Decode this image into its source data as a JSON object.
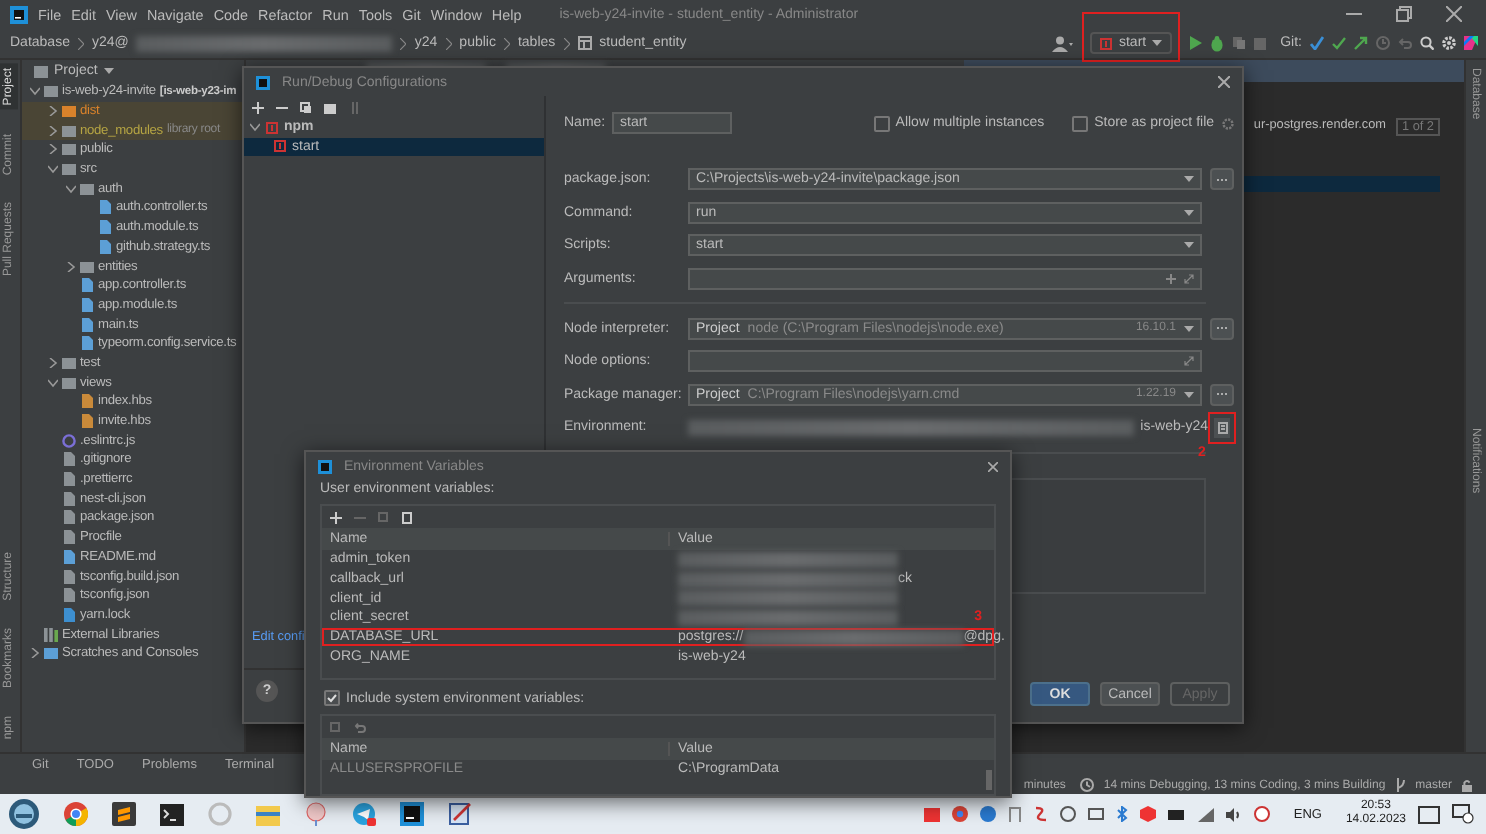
{
  "window": {
    "title": "is-web-y24-invite - student_entity - Administrator",
    "menu": [
      "File",
      "Edit",
      "View",
      "Navigate",
      "Code",
      "Refactor",
      "Run",
      "Tools",
      "Git",
      "Window",
      "Help"
    ]
  },
  "breadcrumbs": [
    "Database",
    "y24@",
    "y24",
    "public",
    "tables",
    "student_entity"
  ],
  "toolbar": {
    "run_config": "start",
    "run_config_marked": true,
    "git_label": "Git:"
  },
  "left_tool_tabs_top": [
    {
      "label": "Project",
      "selected": true
    },
    {
      "label": "Commit",
      "selected": false
    },
    {
      "label": "Pull Requests",
      "selected": false
    }
  ],
  "left_tool_tabs_bottom": [
    {
      "label": "Structure",
      "selected": false
    },
    {
      "label": "Bookmarks",
      "selected": false
    },
    {
      "label": "npm",
      "selected": false
    }
  ],
  "right_tool_tabs": [
    "Database",
    "Notifications"
  ],
  "project_panel": {
    "title": "Project",
    "tree": [
      {
        "label": "is-web-y24-invite",
        "note": "[is-web-y23-im",
        "kind": "module",
        "expanded": true,
        "children": [
          {
            "label": "dist",
            "kind": "excluded-folder",
            "expanded": false
          },
          {
            "label": "node_modules",
            "note": "library root",
            "kind": "library-folder",
            "expanded": false
          },
          {
            "label": "public",
            "kind": "folder",
            "expanded": false
          },
          {
            "label": "src",
            "kind": "folder",
            "expanded": true,
            "children": [
              {
                "label": "auth",
                "kind": "folder",
                "expanded": true,
                "children": [
                  {
                    "label": "auth.controller.ts",
                    "kind": "file-ts"
                  },
                  {
                    "label": "auth.module.ts",
                    "kind": "file-ts"
                  },
                  {
                    "label": "github.strategy.ts",
                    "kind": "file-ts"
                  }
                ]
              },
              {
                "label": "entities",
                "kind": "folder",
                "expanded": false
              },
              {
                "label": "app.controller.ts",
                "kind": "file-ts"
              },
              {
                "label": "app.module.ts",
                "kind": "file-ts"
              },
              {
                "label": "main.ts",
                "kind": "file-ts"
              },
              {
                "label": "typeorm.config.service.ts",
                "kind": "file-ts"
              }
            ]
          },
          {
            "label": "test",
            "kind": "folder",
            "expanded": false
          },
          {
            "label": "views",
            "kind": "folder",
            "expanded": true,
            "children": [
              {
                "label": "index.hbs",
                "kind": "file-hbs"
              },
              {
                "label": "invite.hbs",
                "kind": "file-hbs"
              }
            ]
          },
          {
            "label": ".eslintrc.js",
            "kind": "file-eslint"
          },
          {
            "label": ".gitignore",
            "kind": "file-config"
          },
          {
            "label": ".prettierrc",
            "kind": "file-config"
          },
          {
            "label": "nest-cli.json",
            "kind": "file-config"
          },
          {
            "label": "package.json",
            "kind": "file-config"
          },
          {
            "label": "Procfile",
            "kind": "file-plain"
          },
          {
            "label": "README.md",
            "kind": "file-md"
          },
          {
            "label": "tsconfig.build.json",
            "kind": "file-config"
          },
          {
            "label": "tsconfig.json",
            "kind": "file-config"
          },
          {
            "label": "yarn.lock",
            "kind": "file-lock"
          }
        ]
      },
      {
        "label": "External Libraries",
        "kind": "libraries"
      },
      {
        "label": "Scratches and Consoles",
        "kind": "scratches",
        "expanded": false
      }
    ]
  },
  "editor": {
    "search_text": "ur-postgres.render.com",
    "match_count": "1 of 2"
  },
  "run_dialog": {
    "title": "Run/Debug Configurations",
    "tree": [
      {
        "label": "npm",
        "expanded": true,
        "children": [
          {
            "label": "start",
            "selected": true
          }
        ]
      }
    ],
    "name_label": "Name:",
    "name_value": "start",
    "checkboxes": [
      {
        "label": "Allow multiple instances",
        "checked": false
      },
      {
        "label": "Store as project file",
        "checked": false
      }
    ],
    "fields": [
      {
        "label": "package.json:",
        "kind": "dropdown",
        "value": "C:\\Projects\\is-web-y24-invite\\package.json",
        "browse": true
      },
      {
        "label": "Command:",
        "kind": "dropdown",
        "value": "run",
        "browse": false
      },
      {
        "label": "Scripts:",
        "kind": "dropdown",
        "value": "start",
        "browse": false
      },
      {
        "label": "Arguments:",
        "kind": "arguments",
        "browse": false
      },
      {
        "label": "Node interpreter:",
        "kind": "interpreter",
        "prefix": "Project",
        "value": "node (C:\\Program Files\\nodejs\\node.exe)",
        "version": "16.10.1",
        "browse": true
      },
      {
        "label": "Node options:",
        "kind": "expandable",
        "browse": false
      },
      {
        "label": "Package manager:",
        "kind": "interpreter",
        "prefix": "Project",
        "value": "C:\\Program Files\\nodejs\\yarn.cmd",
        "version": "1.22.19",
        "browse": true
      },
      {
        "label": "Environment:",
        "kind": "environment",
        "value_end": "is-web-y24",
        "annotation": "2",
        "browse": false
      }
    ],
    "link": "Edit confi",
    "help_button": "?",
    "buttons": [
      {
        "label": "OK",
        "kind": "primary"
      },
      {
        "label": "Cancel",
        "kind": "normal"
      },
      {
        "label": "Apply",
        "kind": "disabled"
      }
    ]
  },
  "env_dialog": {
    "title": "Environment Variables",
    "user_label": "User environment variables:",
    "columns": [
      "Name",
      "Value"
    ],
    "rows": [
      {
        "name": "admin_token",
        "blurred": true
      },
      {
        "name": "callback_url",
        "blurred": true,
        "value_end": "ck"
      },
      {
        "name": "client_id",
        "blurred": true
      },
      {
        "name": "client_secret",
        "blurred": true
      },
      {
        "name": "DATABASE_URL",
        "value": "postgres://",
        "blurred": true,
        "value_end": "@dpg.",
        "annotation": "3"
      },
      {
        "name": "ORG_NAME",
        "value": "is-web-y24",
        "blurred": false
      }
    ],
    "system_checkbox": {
      "label": "Include system environment variables:",
      "checked": true
    },
    "system_columns": [
      "Name",
      "Value"
    ],
    "system_rows": [
      {
        "name": "ALLUSERSPROFILE",
        "value": "C:\\ProgramData"
      }
    ]
  },
  "bottom_tabs": [
    "Git",
    "TODO",
    "Problems",
    "Terminal"
  ],
  "status_bar": {
    "left_text": "minutes",
    "time_summary": "14 mins Debugging, 13 mins Coding, 3 mins Building",
    "branch": "master"
  },
  "taskbar": {
    "language": "ENG",
    "time": "20:53",
    "date": "14.02.2023"
  }
}
